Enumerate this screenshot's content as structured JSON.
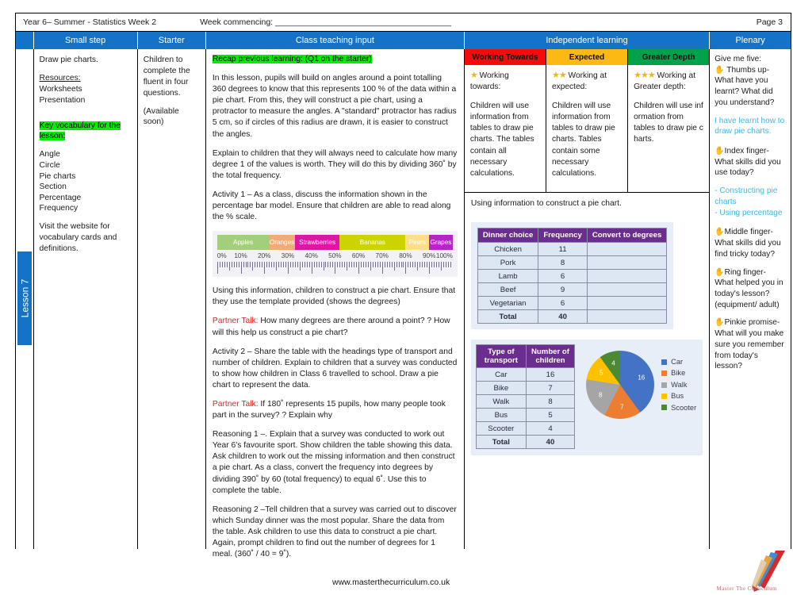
{
  "header": {
    "left": "Year 6– Summer - Statistics Week 2",
    "week_commencing": "Week commencing: ______________________________________",
    "page": "Page 3"
  },
  "lesson_tab": "Lesson 7",
  "columns": {
    "small_step": "Small step",
    "starter": "Starter",
    "class_input": "Class teaching input",
    "independent": "Independent learning",
    "plenary": "Plenary"
  },
  "small_step": {
    "title": "Draw pie charts.",
    "resources_label": "Resources:",
    "resources": [
      "Worksheets",
      "Presentation"
    ],
    "vocab_heading": "Key vocabulary for the lesson:",
    "vocab": [
      "Angle",
      "Circle",
      "Pie charts",
      "Section",
      "Percentage",
      "Frequency"
    ],
    "website_note": "Visit the website for vocabulary cards and definitions."
  },
  "starter": {
    "line1": "Children to complete the fluent in four questions.",
    "line2": "(Available soon)"
  },
  "class_input": {
    "recap": "Recap previous learning: (Q1 on the starter)",
    "para1": "In this lesson, pupils will build on angles around a point totalling 360 degrees to know that this represents 100 % of the data within a pie chart. From this, they will construct a pie chart, using a protractor to measure the angles. A \"standard\" protractor has radius 5 cm, so if circles of this radius are drawn, it is easier to construct the angles.",
    "para2": "Explain to children that they will always need to calculate how many degree 1 of the values is worth.  They will do this by dividing 360˚ by the total frequency.",
    "para3": "Activity 1 – As a class, discuss the information shown in the percentage bar model.  Ensure that children are able to read along the % scale.",
    "para4": "Using this information, children to construct a pie chart. Ensure that they use the template provided (shows the degrees)",
    "partner_talk_1_label": "Partner Talk:",
    "partner_talk_1": " How many degrees are there around a point? ? How will this help us construct a pie chart?",
    "para5": "Activity 2 – Share the table with the headings type of transport and number of children. Explain to children that a survey was conducted to show how children in Class 6 travelled to school. Draw a pie chart to represent the data.",
    "partner_talk_2_label": "Partner Talk:",
    "partner_talk_2": " If 180˚ represents 15 pupils, how many people took part in the survey? ? Explain why",
    "reasoning1": "Reasoning 1 –. Explain that a  survey was conducted to work out Year 6's favourite sport. Show children the table showing this data. Ask children to work out the missing information and then construct a pie chart. As a class, convert the frequency into degrees by dividing 390˚ by 60 (total frequency) to equal 6˚. Use this to complete the table.",
    "reasoning2": "Reasoning 2 –Tell children that a survey was carried out to discover which Sunday dinner was the most popular. Share the data from the table. Ask children to use this data to construct a pie chart. Again, prompt children to find out the number of degrees for 1 meal. (360˚ / 40 = 9˚)."
  },
  "bar_model": {
    "segments": [
      {
        "label": "Apples",
        "pct": 22,
        "color": "#a3cf7a"
      },
      {
        "label": "Oranges",
        "pct": 11,
        "color": "#f0ac77"
      },
      {
        "label": "Strawberries",
        "pct": 19,
        "color": "#dd16a6"
      },
      {
        "label": "Bananas",
        "pct": 28,
        "color": "#ccd400"
      },
      {
        "label": "Pears",
        "pct": 10,
        "color": "#ffde8a"
      },
      {
        "label": "Grapes",
        "pct": 10,
        "color": "#b626c6"
      }
    ],
    "ticks": [
      "0%",
      "10%",
      "20%",
      "30%",
      "40%",
      "50%",
      "60%",
      "70%",
      "80%",
      "90%",
      "100%"
    ]
  },
  "independent": {
    "bands": [
      {
        "title": "Working Towards",
        "color": "#f60a0a",
        "star_count": 1,
        "sub": " Working towards:",
        "body": "Children will use information from tables to draw pie charts. The tables contain all necessary calculations."
      },
      {
        "title": "Expected",
        "color": "#fcb813",
        "star_count": 2,
        "sub": " Working at expected:",
        "body": "Children will use information from tables to draw pie charts. Tables contain some necessary calculations."
      },
      {
        "title": "Greater Depth",
        "color": "#00a14b",
        "star_count": 3,
        "sub": " Working at Greater depth:",
        "body": "Children will use inf ormation from tables to draw pie c harts."
      }
    ],
    "caption": "Using information to construct a pie chart.",
    "dinner_table": {
      "headers": [
        "Dinner choice",
        "Frequency",
        "Convert to degrees"
      ],
      "rows": [
        [
          "Chicken",
          "11",
          ""
        ],
        [
          "Pork",
          "8",
          ""
        ],
        [
          "Lamb",
          "6",
          ""
        ],
        [
          "Beef",
          "9",
          ""
        ],
        [
          "Vegetarian",
          "6",
          ""
        ],
        [
          "Total",
          "40",
          ""
        ]
      ]
    },
    "transport_table": {
      "headers": [
        "Type of transport",
        "Number of children"
      ],
      "rows": [
        [
          "Car",
          "16"
        ],
        [
          "Bike",
          "7"
        ],
        [
          "Walk",
          "8"
        ],
        [
          "Bus",
          "5"
        ],
        [
          "Scooter",
          "4"
        ],
        [
          "Total",
          "40"
        ]
      ]
    }
  },
  "chart_data": {
    "type": "pie",
    "title": "",
    "categories": [
      "Car",
      "Bike",
      "Walk",
      "Bus",
      "Scooter"
    ],
    "values": [
      16,
      7,
      8,
      5,
      4
    ],
    "colors": [
      "#4472c4",
      "#ed7d31",
      "#a5a5a5",
      "#ffc000",
      "#4b8a33"
    ],
    "data_labels": [
      "16",
      "7",
      "8",
      "5",
      "4"
    ],
    "legend_position": "right",
    "total": 40
  },
  "plenary": {
    "intro": "Give me five:",
    "items": [
      {
        "hand": true,
        "q": "Thumbs up- What have you learnt? What did you understand?",
        "a": "I have learnt how to draw pie charts."
      },
      {
        "hand": true,
        "q": "Index finger- What skills did you use today?",
        "a": "- Constructing pie charts\n- Using percentage"
      },
      {
        "hand": true,
        "q": "Middle finger- What skills did you find tricky today?",
        "a": ""
      },
      {
        "hand": true,
        "q": "Ring finger- What helped you in today's lesson? (equipment/ adult)",
        "a": ""
      },
      {
        "hand": true,
        "q": "Pinkie promise- What will you make sure you remember from today's lesson?",
        "a": ""
      }
    ]
  },
  "footer": {
    "url": "www.masterthecurriculum.co.uk",
    "logo_text": "Master The Curriculum"
  }
}
